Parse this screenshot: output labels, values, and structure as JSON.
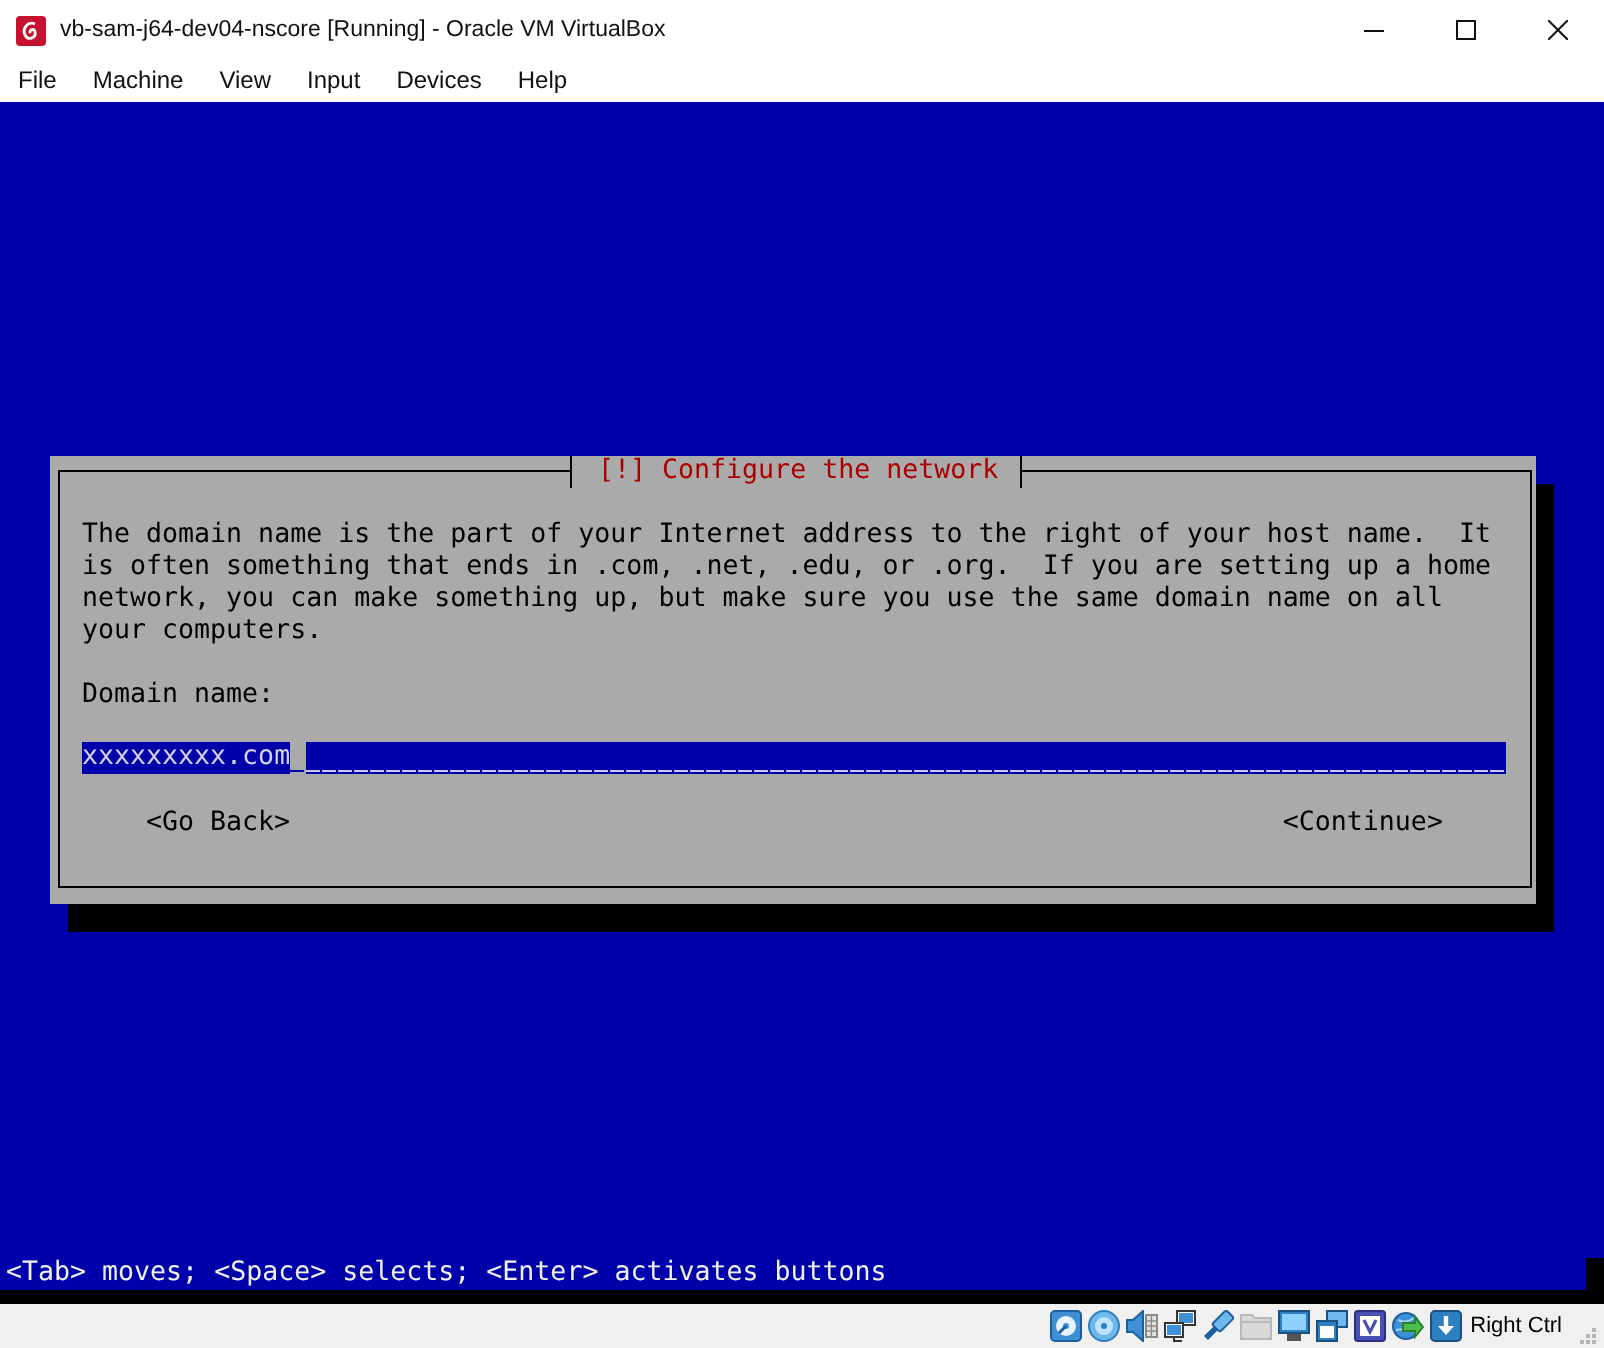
{
  "window": {
    "title": "vb-sam-j64-dev04-nscore [Running] - Oracle VM VirtualBox"
  },
  "menu": [
    "File",
    "Machine",
    "View",
    "Input",
    "Devices",
    "Help"
  ],
  "dialog": {
    "title": "[!] Configure the network",
    "message": "The domain name is the part of your Internet address to the right of your host name.  It is often something that ends in .com, .net, .edu, or .org.  If you are setting up a home network, you can make something up, but make sure you use the same domain name on all your computers.",
    "field_label": "Domain name:",
    "field": {
      "value": "xxxxxxxxx.com"
    },
    "buttons": [
      "<Go Back>",
      "<Continue>"
    ]
  },
  "help_line": "<Tab> moves; <Space> selects; <Enter> activates buttons",
  "status_bar": {
    "indicators": [
      {
        "kind": "disk",
        "disabled": false
      },
      {
        "kind": "disc",
        "disabled": false
      },
      {
        "kind": "audio",
        "disabled": false
      },
      {
        "kind": "network",
        "disabled": false
      },
      {
        "kind": "usb",
        "disabled": false
      },
      {
        "kind": "folder",
        "disabled": true
      },
      {
        "kind": "display",
        "disabled": false
      },
      {
        "kind": "capture",
        "disabled": false
      },
      {
        "kind": "cpu",
        "disabled": false
      },
      {
        "kind": "mouse",
        "disabled": false
      },
      {
        "kind": "keyboard",
        "disabled": false
      }
    ],
    "host_key": "Right Ctrl"
  }
}
